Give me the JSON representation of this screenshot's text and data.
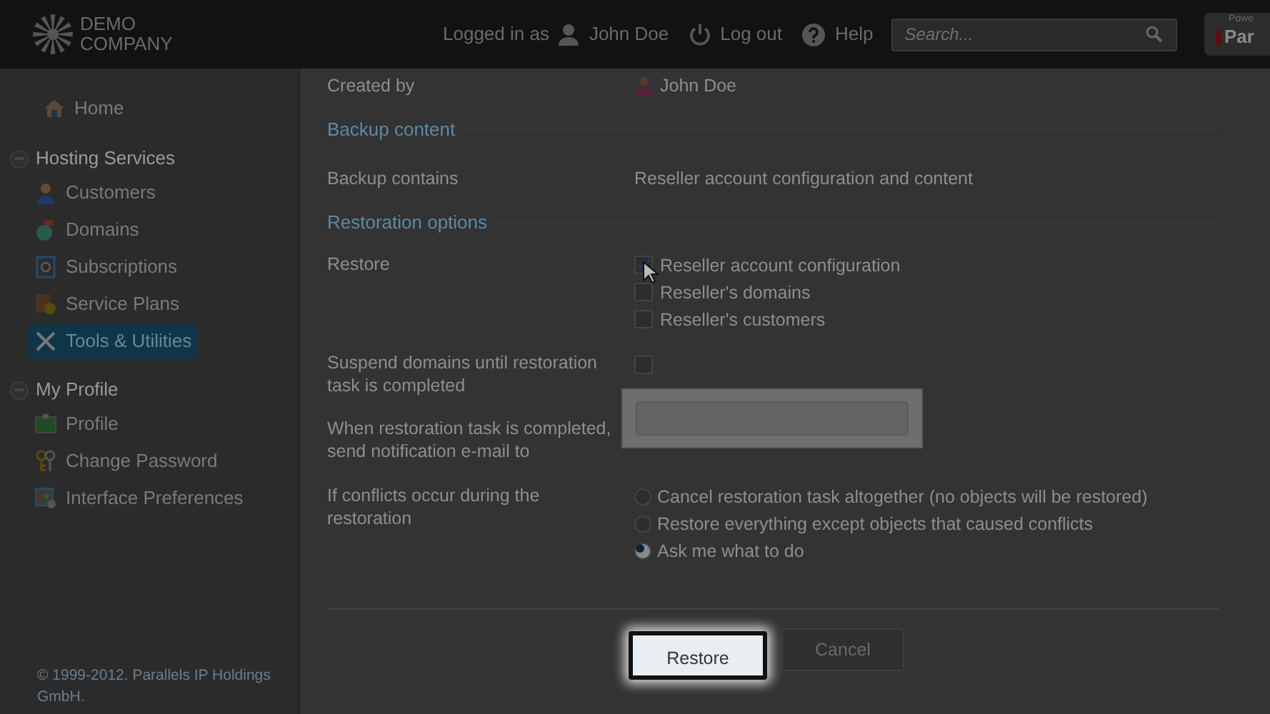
{
  "header": {
    "logo": [
      "DEMO",
      "COMPANY"
    ],
    "logged_in_label": "Logged in as",
    "user": "John Doe",
    "logout": "Log out",
    "help": "Help",
    "search": {
      "placeholder": "Search..."
    },
    "brand": {
      "top": "Powe",
      "name": "Par"
    }
  },
  "sidebar": {
    "items": [
      {
        "kind": "link",
        "label": "Home",
        "selected": false
      },
      {
        "kind": "group",
        "label": "Hosting Services",
        "expanded": true,
        "children": [
          {
            "label": "Customers",
            "selected": false
          },
          {
            "label": "Domains",
            "selected": false
          },
          {
            "label": "Subscriptions",
            "selected": false
          },
          {
            "label": "Service Plans",
            "selected": false
          },
          {
            "label": "Tools & Utilities",
            "selected": true
          }
        ]
      },
      {
        "kind": "group",
        "label": "My Profile",
        "expanded": true,
        "children": [
          {
            "label": "Profile",
            "selected": false
          },
          {
            "label": "Change Password",
            "selected": false
          },
          {
            "label": "Interface Preferences",
            "selected": false
          }
        ]
      }
    ],
    "footer": "© 1999-2012. Parallels IP Holdings GmbH."
  },
  "form": [
    {
      "kind": "user",
      "label": "Created by",
      "value": "John Doe"
    },
    {
      "kind": "section",
      "label": "Backup content"
    },
    {
      "kind": "field",
      "label": "Backup contains",
      "value": "Reseller account configuration and content"
    },
    {
      "kind": "section",
      "label": "Restoration options"
    },
    {
      "kind": "checkboxes",
      "label": "Restore",
      "options": [
        {
          "label": "Reseller account configuration",
          "checked": true
        },
        {
          "label": "Reseller's domains",
          "checked": false
        },
        {
          "label": "Reseller's customers",
          "checked": false
        }
      ]
    },
    {
      "kind": "checkbox",
      "label": "Suspend domains until restoration task is completed",
      "checked": false
    },
    {
      "kind": "input",
      "label": "When restoration task is completed, send notification e-mail to"
    },
    {
      "kind": "radios",
      "label": "If conflicts occur during the restoration",
      "options": [
        {
          "label": "Cancel restoration task altogether (no objects will be restored)",
          "selected": false
        },
        {
          "label": "Restore everything except objects that caused conflicts",
          "selected": false
        },
        {
          "label": "Ask me what to do",
          "selected": true
        }
      ]
    }
  ],
  "buttons": [
    {
      "label": "Restore",
      "highlighted": true
    },
    {
      "label": "Cancel",
      "highlighted": false
    }
  ]
}
